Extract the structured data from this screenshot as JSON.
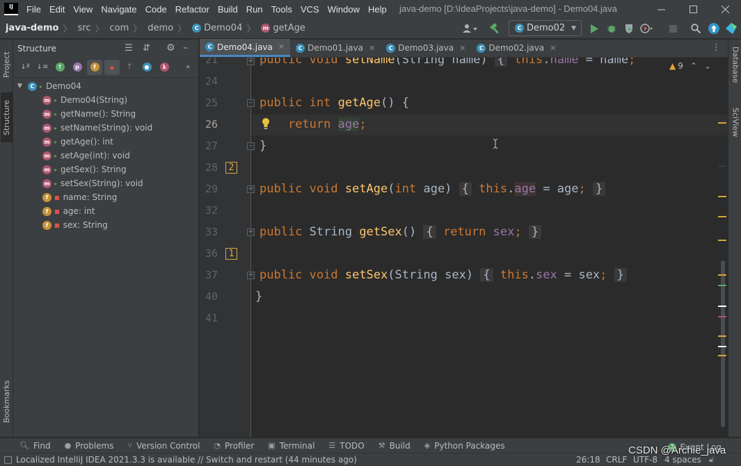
{
  "menu": {
    "logo": "IJ",
    "items": [
      "File",
      "Edit",
      "View",
      "Navigate",
      "Code",
      "Refactor",
      "Build",
      "Run",
      "Tools",
      "VCS",
      "Window",
      "Help"
    ]
  },
  "window": {
    "title": "java-demo [D:\\IdeaProjects\\java-demo] - Demo04.java"
  },
  "breadcrumb": {
    "project": "java-demo",
    "src": "src",
    "com": "com",
    "demo": "demo",
    "class": "Demo04",
    "method": "getAge"
  },
  "run_config": {
    "selected": "Demo02"
  },
  "left_tabs": {
    "project": "Project",
    "structure": "Structure",
    "bookmarks": "Bookmarks"
  },
  "right_tabs": {
    "database": "Database",
    "sciview": "SciView"
  },
  "structure": {
    "title": "Structure",
    "root": "Demo04",
    "items": [
      {
        "kind": "m",
        "access": "public",
        "label": "Demo04(String)"
      },
      {
        "kind": "m",
        "access": "public",
        "label": "getName(): String"
      },
      {
        "kind": "m",
        "access": "public",
        "label": "setName(String): void"
      },
      {
        "kind": "m",
        "access": "public",
        "label": "getAge(): int"
      },
      {
        "kind": "m",
        "access": "public",
        "label": "setAge(int): void"
      },
      {
        "kind": "m",
        "access": "public",
        "label": "getSex(): String"
      },
      {
        "kind": "m",
        "access": "public",
        "label": "setSex(String): void"
      },
      {
        "kind": "f",
        "access": "private",
        "label": "name: String"
      },
      {
        "kind": "f",
        "access": "private",
        "label": "age: int"
      },
      {
        "kind": "f",
        "access": "private",
        "label": "sex: String"
      }
    ]
  },
  "editor": {
    "tabs": [
      "Demo04.java",
      "Demo01.java",
      "Demo03.java",
      "Demo02.java"
    ],
    "warnings": "9",
    "lines": {
      "l21": "21",
      "l24": "24",
      "l25": "25",
      "l26": "26",
      "l27": "27",
      "l28": "28",
      "l29": "29",
      "l32": "32",
      "l33": "33",
      "l36": "36",
      "l37": "37",
      "l40": "40",
      "l41": "41"
    },
    "markers": {
      "m28": "2",
      "m36": "1"
    }
  },
  "bottom_tools": [
    "Find",
    "Problems",
    "Version Control",
    "Profiler",
    "Terminal",
    "TODO",
    "Build",
    "Python Packages"
  ],
  "event_log": {
    "count": "2",
    "label": "Event Log"
  },
  "status": {
    "message": "Localized IntelliJ IDEA 2021.3.3 is available // Switch and restart (44 minutes ago)",
    "position": "26:18",
    "line_sep": "CRLF",
    "encoding": "UTF-8",
    "indent": "4 spaces"
  },
  "watermark": "CSDN @Archie_java",
  "colors": {
    "keyword": "#cc7832",
    "method": "#ffc66d",
    "field": "#9876aa",
    "text": "#a9b7c6",
    "marker": "#d6a83e",
    "tab_accent": "#4a88c7"
  }
}
